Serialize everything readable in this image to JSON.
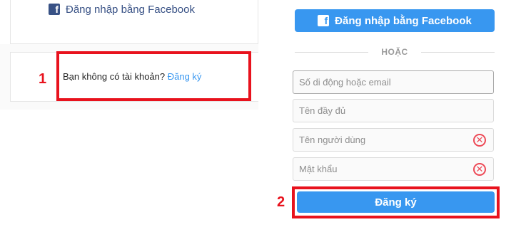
{
  "left": {
    "facebook_login_label": "Đăng nhập bằng Facebook",
    "no_account_text": "Bạn không có tài khoản?",
    "signup_link": "Đăng ký",
    "annotation_number": "1"
  },
  "right": {
    "facebook_button_label": "Đăng nhập bằng Facebook",
    "divider_text": "HOẶC",
    "fields": {
      "contact_placeholder": "Số di động hoặc email",
      "fullname_placeholder": "Tên đầy đủ",
      "username_placeholder": "Tên người dùng",
      "password_placeholder": "Mật khẩu"
    },
    "error_icon_glyph": "✕",
    "signup_button_label": "Đăng ký",
    "annotation_number": "2"
  },
  "colors": {
    "accent": "#3897f0",
    "facebook_blue": "#385185",
    "highlight_red": "#e8121d",
    "error_red": "#ed4956"
  },
  "icons": {
    "facebook": "facebook-icon",
    "error": "error-icon"
  }
}
